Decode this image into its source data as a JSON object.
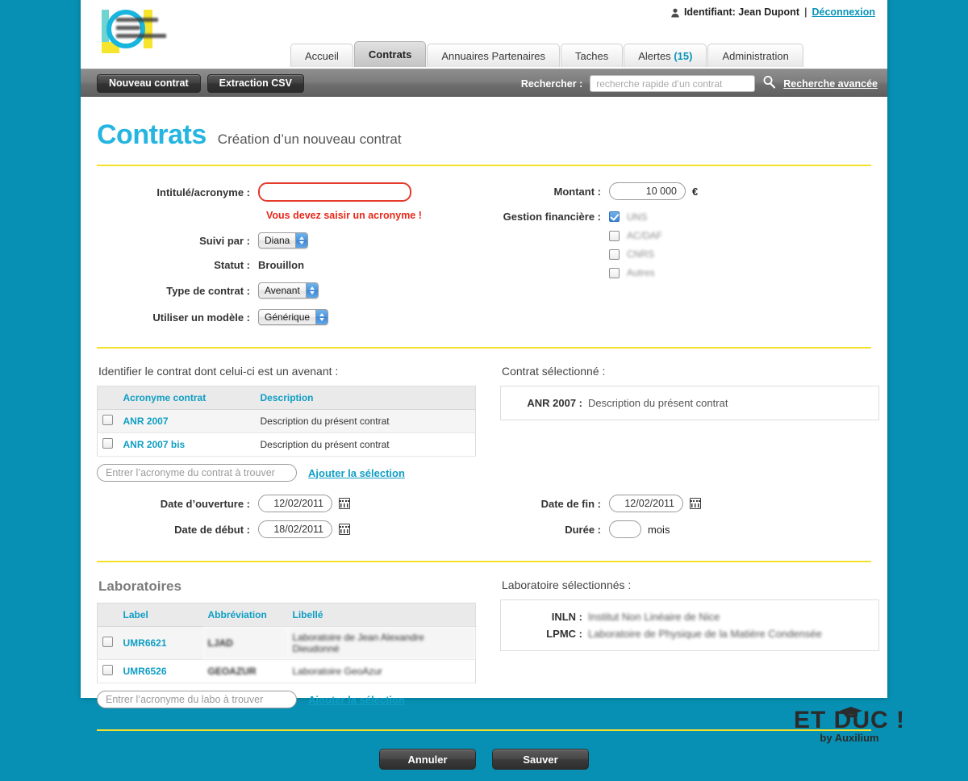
{
  "header": {
    "logo_alt": "Université Nice Sophia Antipolis",
    "user_label": "Identifiant: Jean Dupont",
    "separator": "|",
    "logout": "Déconnexion",
    "tabs": [
      {
        "label": "Accueil",
        "active": false
      },
      {
        "label": "Contrats",
        "active": true
      },
      {
        "label": "Annuaires Partenaires",
        "active": false
      },
      {
        "label": "Taches",
        "active": false
      },
      {
        "label": "Alertes",
        "count": "(15)",
        "active": false
      },
      {
        "label": "Administration",
        "active": false
      }
    ]
  },
  "toolbar": {
    "new_contract": "Nouveau contrat",
    "csv_export": "Extraction CSV",
    "search_label": "Rechercher :",
    "search_placeholder": "recherche rapide d’un contrat",
    "search_value": "",
    "advanced_search": "Recherche avancée"
  },
  "page": {
    "title": "Contrats",
    "subtitle": "Création d’un nouveau contrat"
  },
  "form": {
    "acronym_label": "Intitulé/acronyme :",
    "acronym_value": "",
    "acronym_error": "Vous devez saisir un acronyme !",
    "followed_by_label": "Suivi par :",
    "followed_by_value": "Diana",
    "status_label": "Statut :",
    "status_value": "Brouillon",
    "contract_type_label": "Type de contrat :",
    "contract_type_value": "Avenant",
    "template_label": "Utiliser un modèle :",
    "template_value": "Générique",
    "amount_label": "Montant :",
    "amount_value": "10 000",
    "amount_unit": "€",
    "finance_label": "Gestion financière :",
    "finance_options": [
      {
        "label": "UNS",
        "checked": true
      },
      {
        "label": "AC/DAF",
        "checked": false
      },
      {
        "label": "CNRS",
        "checked": false
      },
      {
        "label": "Autres",
        "checked": false
      }
    ]
  },
  "contracts": {
    "section_label": "Identifier le contrat dont celui-ci est un avenant :",
    "columns": [
      "Acronyme contrat",
      "Description"
    ],
    "rows": [
      {
        "acronym": "ANR 2007",
        "description": "Description du présent contrat"
      },
      {
        "acronym": "ANR 2007 bis",
        "description": "Description du présent contrat"
      }
    ],
    "find_placeholder": "Entrer l’acronyme du contrat à trouver",
    "find_value": "",
    "add_link": "Ajouter la sélection",
    "selected_label": "Contrat sélectionné :",
    "selected": [
      {
        "key": "ANR 2007 :",
        "value": "Description du présent contrat"
      }
    ]
  },
  "dates": {
    "open_label": "Date d’ouverture :",
    "open_value": "12/02/2011",
    "start_label": "Date de début :",
    "start_value": "18/02/2011",
    "end_label": "Date de fin :",
    "end_value": "12/02/2011",
    "duration_label": "Durée :",
    "duration_value": "",
    "duration_unit": "mois"
  },
  "labs": {
    "section_label": "Laboratoires",
    "columns": [
      "Label",
      "Abbréviation",
      "Libellé"
    ],
    "rows": [
      {
        "label": "UMR6621",
        "abbr": "LJAD",
        "name": "Laboratoire de Jean Alexandre Dieudonné"
      },
      {
        "label": "UMR6526",
        "abbr": "GEOAZUR",
        "name": "Laboratoire GeoAzur"
      }
    ],
    "find_placeholder": "Entrer l’acronyme du labo à trouver",
    "find_value": "",
    "add_link": "Ajouter la sélection",
    "selected_label": "Laboratoire sélectionnés :",
    "selected": [
      {
        "key": "INLN :",
        "value": "Institut Non Linéaire de Nice"
      },
      {
        "key": "LPMC :",
        "value": "Laboratoire de Physique de la Matière Condensée"
      }
    ]
  },
  "actions": {
    "cancel": "Annuler",
    "save": "Sauver"
  },
  "brand": {
    "name_1": "ET D",
    "name_2": "C !",
    "tagline": "by Auxilium"
  },
  "colors": {
    "page_background": "#0790b3",
    "accent_teal": "#25b5e0",
    "link_teal": "#0f9ec4",
    "rule_yellow": "#f5e12b",
    "error_red": "#e8291b"
  }
}
